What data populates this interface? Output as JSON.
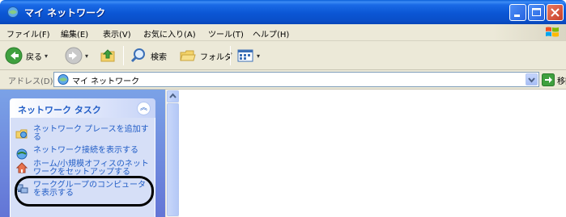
{
  "window": {
    "title": "マイ ネットワーク"
  },
  "menu": {
    "items": [
      "ファイル(F)",
      "編集(E)",
      "表示(V)",
      "お気に入り(A)",
      "ツール(T)",
      "ヘルプ(H)"
    ]
  },
  "toolbar": {
    "back_label": "戻る",
    "search_label": "検索",
    "folders_label": "フォルダ"
  },
  "address": {
    "label": "アドレス(D)",
    "value": "マイ ネットワーク",
    "go_label": "移動"
  },
  "taskpane": {
    "title": "ネットワーク タスク",
    "collapse_glyph": "︽",
    "tasks": [
      {
        "label": "ネットワーク プレースを追加する",
        "icon": "add-network-place-icon"
      },
      {
        "label": "ネットワーク接続を表示する",
        "icon": "network-connections-icon"
      },
      {
        "label": "ホーム/小規模オフィスのネットワークをセットアップする",
        "icon": "home-network-setup-icon"
      },
      {
        "label": "ワークグループのコンピュータを表示する",
        "icon": "workgroup-computers-icon"
      }
    ]
  },
  "colors": {
    "titlebar": "#0a56d4",
    "task_link": "#215dc6",
    "taskpane_bg": "#7ba2e7",
    "highlight_ring": "#000000"
  }
}
